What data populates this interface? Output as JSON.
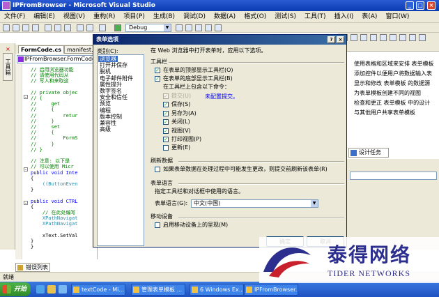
{
  "window": {
    "title": "IPFromBrowser - Microsoft Visual Studio"
  },
  "menu": [
    "文件(F)",
    "编辑(E)",
    "视图(V)",
    "重构(R)",
    "项目(P)",
    "生成(B)",
    "调试(D)",
    "数据(A)",
    "格式(O)",
    "测试(S)",
    "工具(T)",
    "插入(I)",
    "表(A)",
    "窗口(W)",
    "社区(C)",
    "帮助(H)"
  ],
  "toolbar": {
    "config": "Debug"
  },
  "toolbox": {
    "label": "工具箱"
  },
  "editor": {
    "tabs": [
      "FormCode.cs",
      "manifest.x"
    ],
    "nav_combo": "IPFromBrowser.FormCode",
    "lines": [
      {
        "text": "// 启用浏览器功能",
        "cls": "c-comment"
      },
      {
        "text": "// 请使用代码从",
        "cls": "c-comment"
      },
      {
        "text": "// 写入和来取这",
        "cls": "c-comment"
      },
      {
        "text": "",
        "cls": "c-plain"
      },
      {
        "text": "// private objec",
        "cls": "c-comment"
      },
      {
        "text": "// {",
        "cls": "c-comment"
      },
      {
        "text": "//     get",
        "cls": "c-comment"
      },
      {
        "text": "//     {",
        "cls": "c-comment"
      },
      {
        "text": "//         retur",
        "cls": "c-comment"
      },
      {
        "text": "//     }",
        "cls": "c-comment"
      },
      {
        "text": "//     set",
        "cls": "c-comment"
      },
      {
        "text": "//     {",
        "cls": "c-comment"
      },
      {
        "text": "//         FormS",
        "cls": "c-comment"
      },
      {
        "text": "//     }",
        "cls": "c-comment"
      },
      {
        "text": "// }",
        "cls": "c-comment"
      },
      {
        "text": "",
        "cls": "c-plain"
      },
      {
        "text": "// 注意: 以下是",
        "cls": "c-comment"
      },
      {
        "text": "// 可以使用 Micr",
        "cls": "c-comment"
      },
      {
        "text": "public void Inte",
        "cls": "c-kw"
      },
      {
        "text": "{",
        "cls": "c-plain"
      },
      {
        "text": "    ((ButtonEven",
        "cls": "c-teal"
      },
      {
        "text": "}",
        "cls": "c-plain"
      },
      {
        "text": "",
        "cls": "c-plain"
      },
      {
        "text": "public void CTRL",
        "cls": "c-kw"
      },
      {
        "text": "{",
        "cls": "c-plain"
      },
      {
        "text": "    // 在此处编写",
        "cls": "c-comment"
      },
      {
        "text": "    XPathNavigat",
        "cls": "c-teal"
      },
      {
        "text": "    XPathNavigat",
        "cls": "c-teal"
      },
      {
        "text": "",
        "cls": "c-plain"
      },
      {
        "text": "    xText.SetVal",
        "cls": "c-plain"
      },
      {
        "text": "}",
        "cls": "c-plain"
      },
      {
        "text": "}",
        "cls": "c-plain"
      }
    ]
  },
  "task_panel": {
    "lines": [
      "使用表格和区域来安排 表单模板",
      "添加控件以便用户将数据输入表",
      "显示和修改 表单模板 的数据源",
      "为表单模板创建不同的视图",
      "检查和更正 表单模板 中的设计",
      "与其他用户共享表单模板"
    ],
    "tab": "设计任务"
  },
  "error_tab": "错误列表",
  "status": "就绪",
  "taskbar": {
    "start": "开始",
    "buttons": [
      "textCode - Mi...",
      "管理表单模板 ...",
      "6 Windows Ex...",
      "IPFromBrowser..."
    ]
  },
  "dialog": {
    "title": "表单选项",
    "category_label": "类别(C):",
    "categories": [
      "浏览器",
      "打开并保存",
      "脱机",
      "电子邮件附件",
      "属性提升",
      "数字签名",
      "安全和信任",
      "预览",
      "编程",
      "版本控制",
      "兼容性",
      "高级"
    ],
    "selected_category": 0,
    "intro": "在 Web 浏览器中打开表单时，应用以下选项。",
    "toolbar_group": "工具栏",
    "show_top": "在表单的顶部显示工具栏(O)",
    "show_bottom": "在表单的底部显示工具栏(B)",
    "commands_intro": "在工具栏上包含以下命令：",
    "commands": [
      {
        "label": "提交(U)",
        "checked": true,
        "disabled": true
      },
      {
        "label": "保存(S)",
        "checked": true,
        "disabled": false
      },
      {
        "label": "另存为(A)",
        "checked": true,
        "disabled": false
      },
      {
        "label": "关闭(L)",
        "checked": true,
        "disabled": false
      },
      {
        "label": "视图(V)",
        "checked": true,
        "disabled": false
      },
      {
        "label": "打印视图(P)",
        "checked": true,
        "disabled": false
      },
      {
        "label": "更新(E)",
        "checked": false,
        "disabled": false
      }
    ],
    "config_submit_link": "未配置提交。",
    "refresh_group": "刷新数据",
    "refresh_option": "如果表单数据在处理过程中可能发生更改，则提交前刷新该表单(R)",
    "lang_group": "表单语言",
    "lang_intro": "指定工具栏和对话框中使用的语言。",
    "lang_label": "表单语言(G):",
    "lang_value": "中文(中国)",
    "mobile_group": "移动设备",
    "mobile_option": "启用移动设备上的呈现(M)",
    "ok": "确定",
    "cancel": "取消"
  },
  "watermark": {
    "cn": "泰得网络",
    "en": "TIDER NETWORKS"
  }
}
